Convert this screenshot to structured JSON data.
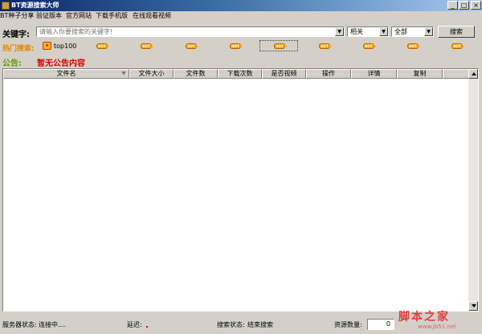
{
  "window": {
    "title": "BT资源搜索大师",
    "min_label": "_",
    "max_label": "□",
    "close_label": "×"
  },
  "menu": {
    "items": [
      "BT种子分享",
      "验证版本",
      "官方网站",
      "下载手机版",
      "在线观看视频"
    ]
  },
  "search": {
    "label": "关键字:",
    "placeholder": "请输入你要搜索的关键字!",
    "mode_value": "相关",
    "category_value": "全部",
    "button_label": "搜索"
  },
  "hot": {
    "label": "热门搜索:",
    "first_item": "top100",
    "badge_text": "HOT"
  },
  "notice": {
    "label": "公告:",
    "text": "暂无公告内容"
  },
  "table": {
    "columns": [
      "文件名",
      "文件大小",
      "文件数",
      "下载次数",
      "是否视频",
      "操作",
      "详情",
      "复制"
    ]
  },
  "status": {
    "server_label": "服务器状态:",
    "server_value": "连接中....",
    "delay_label": "延迟:",
    "search_label": "搜索状态:",
    "search_value": "结束搜索",
    "count_label": "资源数量:",
    "count_value": "0"
  },
  "watermark": {
    "text": "脚本之家",
    "url": "www.jb51.net"
  },
  "colors": {
    "hot": "#e08a00",
    "notice_label": "#6a9a00",
    "notice_text": "#e00000",
    "accent_badge": "#ffa000"
  }
}
